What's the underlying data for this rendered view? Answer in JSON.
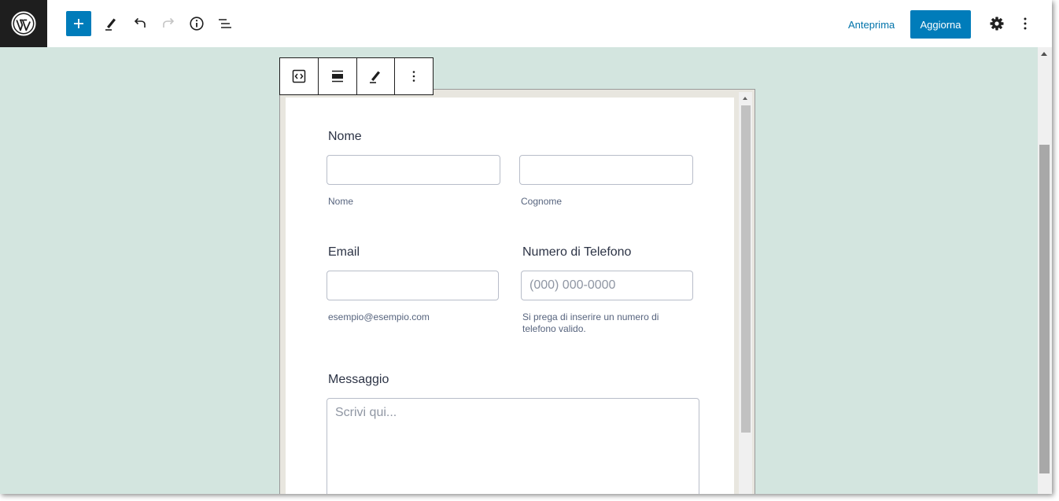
{
  "toolbar": {
    "add_icon": "plus-icon",
    "tools_icon": "pencil-icon",
    "undo_icon": "undo-icon",
    "redo_icon": "redo-icon",
    "info_icon": "info-icon",
    "list_view_icon": "list-view-icon",
    "preview_label": "Anteprima",
    "update_label": "Aggiorna",
    "settings_icon": "gear-icon",
    "more_icon": "more-vertical-icon"
  },
  "block_toolbar": {
    "items": [
      "embed-icon",
      "align-icon",
      "pencil-icon",
      "more-vertical-icon"
    ]
  },
  "form": {
    "name_label": "Nome",
    "first_name_sublabel": "Nome",
    "last_name_sublabel": "Cognome",
    "email_label": "Email",
    "email_sublabel": "esempio@esempio.com",
    "phone_label": "Numero di Telefono",
    "phone_placeholder": "(000) 000-0000",
    "phone_sublabel": "Si prega di inserire un numero di telefono valido.",
    "message_label": "Messaggio",
    "message_placeholder": "Scrivi qui..."
  },
  "colors": {
    "accent": "#007cba",
    "canvas_bg": "#d3e5df",
    "logo_bg": "#1e1e1e"
  }
}
